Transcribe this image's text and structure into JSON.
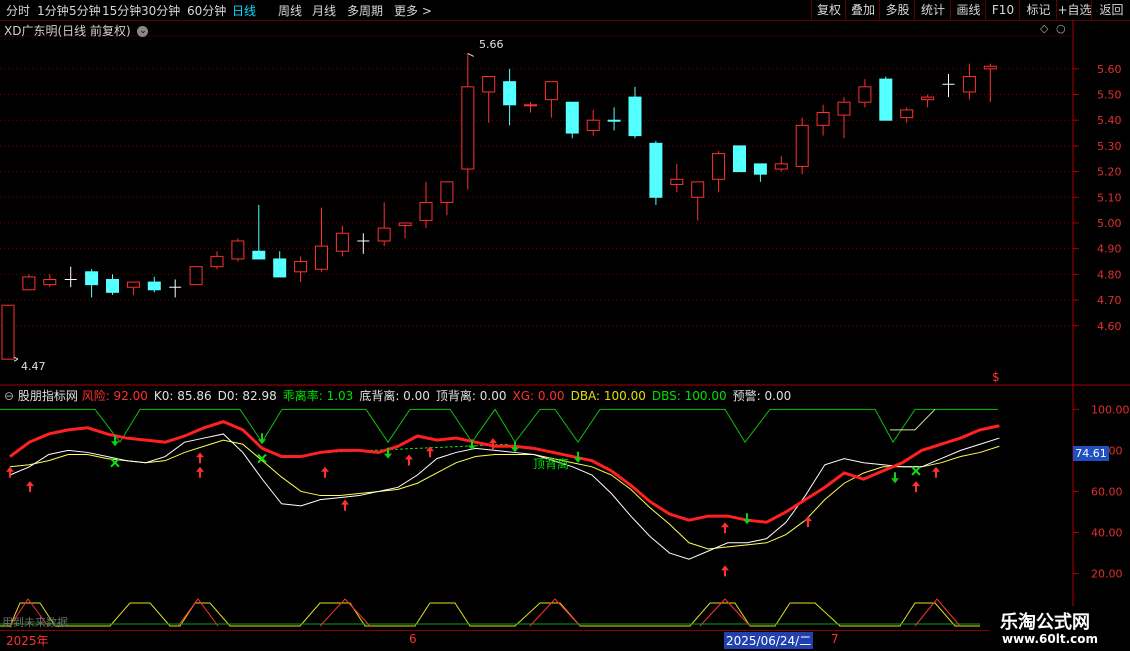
{
  "toolbar": {
    "tabs": [
      "分时",
      "1分钟",
      "5分钟",
      "15分钟",
      "30分钟",
      "60分钟",
      "日线",
      "周线",
      "月线",
      "多周期",
      "更多 >"
    ],
    "active": "日线",
    "right_buttons": [
      "复权",
      "叠加",
      "多股",
      "统计",
      "画线",
      "F10",
      "标记",
      "+自选",
      "返回"
    ]
  },
  "price_panel": {
    "title": "XD广东明(日线 前复权)",
    "max_label": "5.66",
    "min_label": "4.47",
    "dollar_mark": "$"
  },
  "indicator_panel": {
    "name": "股朋指标网",
    "items": [
      {
        "label": "风险:",
        "value": "92.00",
        "color": "#ff3030"
      },
      {
        "label": "K0:",
        "value": "85.86",
        "color": "#e0e0e0"
      },
      {
        "label": "D0:",
        "value": "82.98",
        "color": "#e0e0e0"
      },
      {
        "label": "乖离率:",
        "value": "1.03",
        "color": "#00e000"
      },
      {
        "label": "底背离:",
        "value": "0.00",
        "color": "#e0e0e0"
      },
      {
        "label": "顶背离:",
        "value": "0.00",
        "color": "#e0e0e0"
      },
      {
        "label": "XG:",
        "value": "0.00",
        "color": "#ff3030"
      },
      {
        "label": "DBA:",
        "value": "100.00",
        "color": "#e0e000"
      },
      {
        "label": "DBS:",
        "value": "100.00",
        "color": "#00e000"
      },
      {
        "label": "预警:",
        "value": "0.00",
        "color": "#e0e0e0"
      }
    ],
    "current_label": "74.61",
    "annotation": "顶背离",
    "hint": "用到未来数据"
  },
  "dates": {
    "year": "2025年",
    "month_6": "6",
    "selected": "2025/06/24/二",
    "month_7": "7"
  },
  "watermark": {
    "cn": "乐淘公式网",
    "url": "www.60lt.com"
  },
  "chart_data": [
    {
      "type": "candlestick",
      "title": "XD广东明(日线 前复权)",
      "ylim": [
        4.42,
        5.72
      ],
      "y_ticks": [
        4.6,
        4.7,
        4.8,
        4.9,
        5.0,
        5.1,
        5.2,
        5.3,
        5.4,
        5.5,
        5.6
      ],
      "candles": [
        {
          "o": 4.47,
          "h": 4.68,
          "l": 4.47,
          "c": 4.68,
          "col": "r"
        },
        {
          "o": 4.74,
          "h": 4.8,
          "l": 4.74,
          "c": 4.79,
          "col": "r"
        },
        {
          "o": 4.76,
          "h": 4.8,
          "l": 4.75,
          "c": 4.78,
          "col": "r"
        },
        {
          "o": 4.78,
          "h": 4.83,
          "l": 4.75,
          "c": 4.78,
          "col": "w"
        },
        {
          "o": 4.81,
          "h": 4.82,
          "l": 4.71,
          "c": 4.76,
          "col": "c"
        },
        {
          "o": 4.78,
          "h": 4.8,
          "l": 4.72,
          "c": 4.73,
          "col": "c"
        },
        {
          "o": 4.75,
          "h": 4.77,
          "l": 4.72,
          "c": 4.77,
          "col": "r"
        },
        {
          "o": 4.77,
          "h": 4.79,
          "l": 4.73,
          "c": 4.74,
          "col": "c"
        },
        {
          "o": 4.75,
          "h": 4.78,
          "l": 4.71,
          "c": 4.75,
          "col": "w"
        },
        {
          "o": 4.76,
          "h": 4.83,
          "l": 4.76,
          "c": 4.83,
          "col": "r"
        },
        {
          "o": 4.83,
          "h": 4.89,
          "l": 4.82,
          "c": 4.87,
          "col": "r"
        },
        {
          "o": 4.86,
          "h": 4.94,
          "l": 4.85,
          "c": 4.93,
          "col": "r"
        },
        {
          "o": 4.89,
          "h": 5.07,
          "l": 4.86,
          "c": 4.86,
          "col": "c"
        },
        {
          "o": 4.86,
          "h": 4.89,
          "l": 4.79,
          "c": 4.79,
          "col": "c"
        },
        {
          "o": 4.81,
          "h": 4.87,
          "l": 4.77,
          "c": 4.85,
          "col": "r"
        },
        {
          "o": 4.82,
          "h": 5.06,
          "l": 4.81,
          "c": 4.91,
          "col": "r"
        },
        {
          "o": 4.89,
          "h": 4.99,
          "l": 4.87,
          "c": 4.96,
          "col": "r"
        },
        {
          "o": 4.93,
          "h": 4.96,
          "l": 4.88,
          "c": 4.93,
          "col": "w"
        },
        {
          "o": 4.93,
          "h": 5.08,
          "l": 4.91,
          "c": 4.98,
          "col": "r"
        },
        {
          "o": 4.99,
          "h": 5.0,
          "l": 4.94,
          "c": 5.0,
          "col": "r"
        },
        {
          "o": 5.01,
          "h": 5.16,
          "l": 4.98,
          "c": 5.08,
          "col": "r"
        },
        {
          "o": 5.08,
          "h": 5.16,
          "l": 5.03,
          "c": 5.16,
          "col": "r"
        },
        {
          "o": 5.21,
          "h": 5.66,
          "l": 5.13,
          "c": 5.53,
          "col": "r"
        },
        {
          "o": 5.51,
          "h": 5.57,
          "l": 5.39,
          "c": 5.57,
          "col": "r"
        },
        {
          "o": 5.55,
          "h": 5.6,
          "l": 5.38,
          "c": 5.46,
          "col": "c"
        },
        {
          "o": 5.46,
          "h": 5.47,
          "l": 5.43,
          "c": 5.46,
          "col": "r"
        },
        {
          "o": 5.48,
          "h": 5.55,
          "l": 5.41,
          "c": 5.55,
          "col": "r"
        },
        {
          "o": 5.47,
          "h": 5.47,
          "l": 5.33,
          "c": 5.35,
          "col": "c"
        },
        {
          "o": 5.36,
          "h": 5.44,
          "l": 5.34,
          "c": 5.4,
          "col": "r"
        },
        {
          "o": 5.4,
          "h": 5.45,
          "l": 5.36,
          "c": 5.4,
          "col": "c"
        },
        {
          "o": 5.49,
          "h": 5.53,
          "l": 5.33,
          "c": 5.34,
          "col": "c"
        },
        {
          "o": 5.31,
          "h": 5.32,
          "l": 5.07,
          "c": 5.1,
          "col": "c"
        },
        {
          "o": 5.15,
          "h": 5.23,
          "l": 5.12,
          "c": 5.17,
          "col": "r"
        },
        {
          "o": 5.1,
          "h": 5.16,
          "l": 5.01,
          "c": 5.16,
          "col": "r"
        },
        {
          "o": 5.17,
          "h": 5.28,
          "l": 5.12,
          "c": 5.27,
          "col": "r"
        },
        {
          "o": 5.3,
          "h": 5.3,
          "l": 5.2,
          "c": 5.2,
          "col": "c"
        },
        {
          "o": 5.23,
          "h": 5.23,
          "l": 5.16,
          "c": 5.19,
          "col": "c"
        },
        {
          "o": 5.21,
          "h": 5.26,
          "l": 5.2,
          "c": 5.23,
          "col": "r"
        },
        {
          "o": 5.22,
          "h": 5.41,
          "l": 5.19,
          "c": 5.38,
          "col": "r"
        },
        {
          "o": 5.38,
          "h": 5.46,
          "l": 5.34,
          "c": 5.43,
          "col": "r"
        },
        {
          "o": 5.42,
          "h": 5.49,
          "l": 5.33,
          "c": 5.47,
          "col": "r"
        },
        {
          "o": 5.47,
          "h": 5.56,
          "l": 5.45,
          "c": 5.53,
          "col": "r"
        },
        {
          "o": 5.56,
          "h": 5.57,
          "l": 5.4,
          "c": 5.4,
          "col": "c"
        },
        {
          "o": 5.41,
          "h": 5.45,
          "l": 5.39,
          "c": 5.44,
          "col": "r"
        },
        {
          "o": 5.48,
          "h": 5.5,
          "l": 5.45,
          "c": 5.49,
          "col": "r"
        },
        {
          "o": 5.54,
          "h": 5.58,
          "l": 5.49,
          "c": 5.54,
          "col": "w"
        },
        {
          "o": 5.51,
          "h": 5.62,
          "l": 5.48,
          "c": 5.57,
          "col": "r"
        },
        {
          "o": 5.6,
          "h": 5.62,
          "l": 5.47,
          "c": 5.61,
          "col": "r"
        }
      ]
    },
    {
      "type": "line",
      "title": "股朋指标网",
      "ylim": [
        12,
        106
      ],
      "y_ticks": [
        20,
        40,
        60,
        80,
        100
      ],
      "series": [
        {
          "name": "风险",
          "color": "#ff2020",
          "values": [
            77,
            84,
            88,
            90,
            91,
            88,
            86,
            85,
            84,
            87,
            91,
            94,
            90,
            81,
            77,
            77,
            79,
            80,
            80,
            79,
            82,
            87,
            85,
            86,
            84,
            82,
            82,
            81,
            79,
            77,
            75,
            70,
            63,
            55,
            49,
            46,
            48,
            48,
            46,
            45,
            50,
            56,
            62,
            69,
            66,
            70,
            74,
            80,
            83,
            86,
            90,
            92
          ]
        },
        {
          "name": "K0",
          "color": "#ffffff",
          "values": [
            68,
            72,
            78,
            80,
            79,
            77,
            75,
            74,
            77,
            84,
            86,
            88,
            79,
            66,
            54,
            53,
            56,
            57,
            58,
            60,
            62,
            68,
            76,
            79,
            81,
            80,
            79,
            78,
            75,
            72,
            68,
            59,
            48,
            38,
            30,
            27,
            31,
            35,
            35,
            37,
            45,
            58,
            73,
            76,
            74,
            73,
            72,
            72,
            76,
            80,
            83,
            86
          ]
        },
        {
          "name": "D0",
          "color": "#ffff50",
          "values": [
            72,
            73,
            75,
            78,
            78,
            76,
            75,
            74,
            75,
            79,
            82,
            85,
            83,
            75,
            67,
            60,
            58,
            58,
            59,
            60,
            61,
            64,
            69,
            74,
            77,
            78,
            78,
            78,
            76,
            74,
            72,
            68,
            61,
            52,
            44,
            35,
            32,
            33,
            34,
            35,
            39,
            46,
            56,
            64,
            69,
            72,
            72,
            72,
            74,
            77,
            79,
            82
          ]
        }
      ]
    }
  ]
}
